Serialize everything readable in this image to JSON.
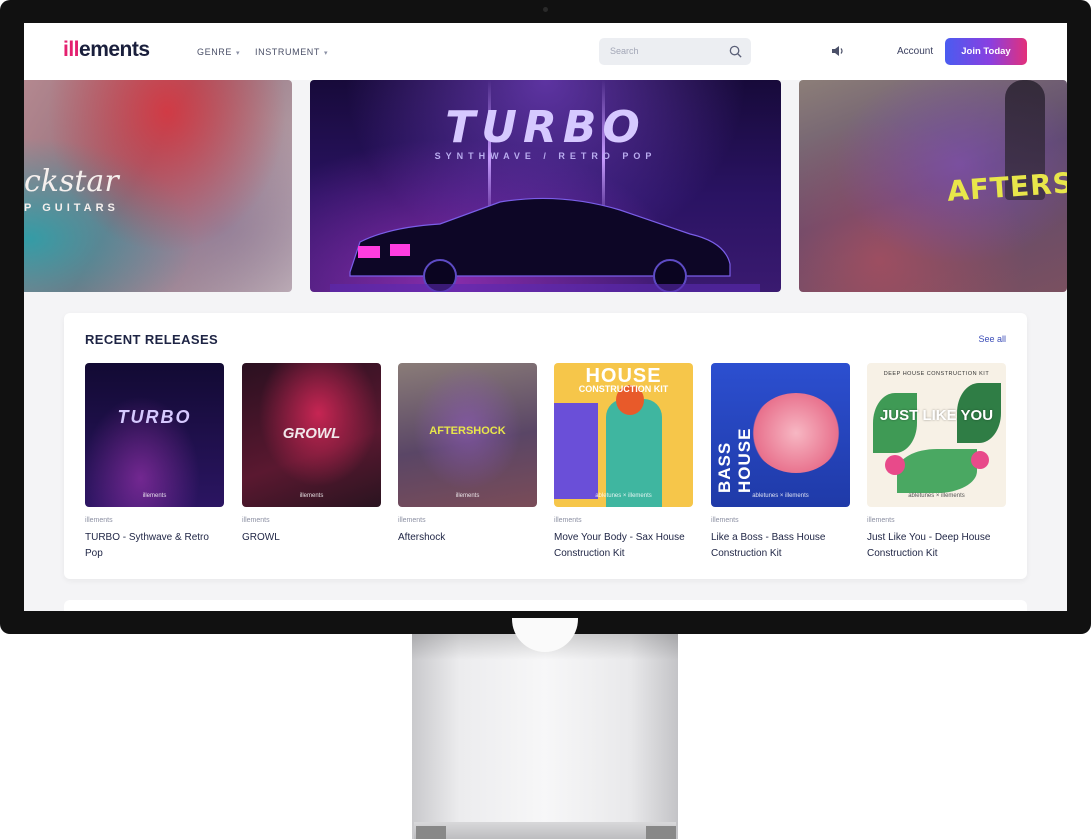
{
  "header": {
    "logo_part1": "ill",
    "logo_part2": "ements",
    "nav": [
      {
        "label": "GENRE"
      },
      {
        "label": "INSTRUMENT"
      }
    ],
    "search_placeholder": "Search",
    "account_label": "Account",
    "join_label": "Join Today"
  },
  "carousel": {
    "left": {
      "title": "ckstar",
      "subtitle": "P GUITARS"
    },
    "center": {
      "title": "TURBO",
      "subtitle": "SYNTHWAVE / RETRO POP"
    },
    "right": {
      "title": "AFTERSHOC"
    }
  },
  "recent_releases": {
    "title": "RECENT RELEASES",
    "see_all": "See all",
    "items": [
      {
        "publisher": "illements",
        "title": "TURBO - Sythwave & Retro Pop",
        "cover_text": "TURBO",
        "cover_label": "illements"
      },
      {
        "publisher": "illements",
        "title": "GROWL",
        "cover_text": "GROWL",
        "cover_label": "illements"
      },
      {
        "publisher": "illements",
        "title": "Aftershock",
        "cover_text": "AFTERSHOCK",
        "cover_label": "illements"
      },
      {
        "publisher": "illements",
        "title": "Move Your Body - Sax House Construction Kit",
        "cover_text": "HOUSE",
        "cover_sub": "CONSTRUCTION KIT",
        "cover_label": "abletunes × illements"
      },
      {
        "publisher": "illements",
        "title": "Like a Boss - Bass House Construction Kit",
        "cover_text": "BASS HOUSE",
        "cover_label": "abletunes × illements"
      },
      {
        "publisher": "illements",
        "title": "Just Like You - Deep House Construction Kit",
        "cover_text": "JUST LIKE YOU",
        "cover_top": "DEEP HOUSE CONSTRUCTION KIT",
        "cover_label": "abletunes × illements"
      }
    ]
  },
  "colors": {
    "accent_pink": "#e4206f",
    "accent_blue": "#4a5cf0",
    "navy_text": "#1e2444"
  }
}
